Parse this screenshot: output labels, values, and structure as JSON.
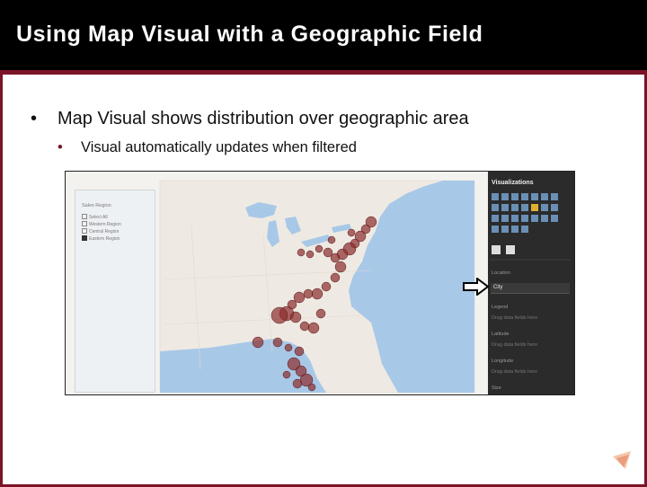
{
  "slide": {
    "title": "Using Map Visual with a Geographic Field",
    "bullet_main": "Map Visual shows distribution over geographic area",
    "bullet_sub": "Visual automatically updates when filtered"
  },
  "slicer": {
    "title": "Sales Region",
    "items": [
      {
        "label": "Select All",
        "checked": false
      },
      {
        "label": "Western Region",
        "checked": false
      },
      {
        "label": "Central Region",
        "checked": false
      },
      {
        "label": "Eastern Region",
        "checked": true
      }
    ]
  },
  "visualizations_pane": {
    "title": "Visualizations",
    "fields": [
      {
        "label": "Location",
        "kind": "header"
      },
      {
        "label": "City",
        "kind": "field"
      },
      {
        "label": "Legend",
        "kind": "header"
      },
      {
        "label": "Drag data fields here",
        "kind": "placeholder"
      },
      {
        "label": "Latitude",
        "kind": "header"
      },
      {
        "label": "Drag data fields here",
        "kind": "placeholder"
      },
      {
        "label": "Longitude",
        "kind": "header"
      },
      {
        "label": "Drag data fields here",
        "kind": "placeholder"
      },
      {
        "label": "Size",
        "kind": "header"
      }
    ]
  },
  "colors": {
    "accent": "#7a1426",
    "bubble": "#8b2c2c",
    "water": "#a8c8e8",
    "land": "#f2efe9"
  },
  "icons": [
    "arrow-right-icon",
    "logo-icon",
    "pin-icon",
    "paint-roller-icon"
  ]
}
